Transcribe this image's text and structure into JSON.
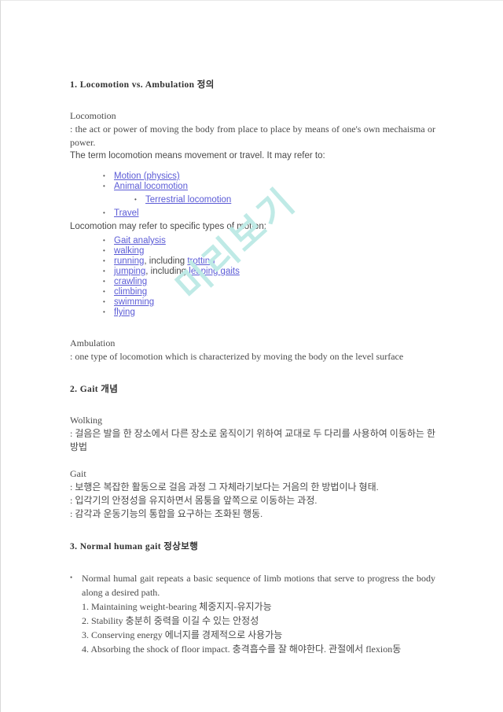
{
  "watermark": {
    "text": "미리보기"
  },
  "sections": {
    "s1": {
      "heading": "1. Locomotion vs. Ambulation 정의",
      "locomotion_title": "Locomotion",
      "locomotion_def": ": the act or power of moving the body from place to place by means of one's own mechaisma or power.",
      "locomotion_intro": "The term locomotion means movement or travel. It may refer to:",
      "links_1": [
        {
          "label": "Motion (physics)",
          "level": 1
        },
        {
          "label": "Animal locomotion",
          "level": 1
        },
        {
          "label": "Terrestrial locomotion",
          "level": 2
        },
        {
          "label": "Travel",
          "level": 1
        }
      ],
      "specific_intro": "Locomotion may refer to specific types of motion:",
      "links_2": [
        {
          "pre": "",
          "label": "Gait analysis",
          "mid": "",
          "label2": "",
          "post": ""
        },
        {
          "pre": "",
          "label": "walking",
          "mid": "",
          "label2": "",
          "post": ""
        },
        {
          "pre": "",
          "label": "running",
          "mid": ", including ",
          "label2": "trotting",
          "post": ""
        },
        {
          "pre": "",
          "label": "jumping",
          "mid": ", including ",
          "label2": "leaping gaits",
          "post": ""
        },
        {
          "pre": "",
          "label": "crawling",
          "mid": "",
          "label2": "",
          "post": ""
        },
        {
          "pre": "",
          "label": "climbing",
          "mid": "",
          "label2": "",
          "post": ""
        },
        {
          "pre": "",
          "label": "swimming",
          "mid": "",
          "label2": "",
          "post": ""
        },
        {
          "pre": "",
          "label": "flying",
          "mid": "",
          "label2": "",
          "post": ""
        }
      ],
      "ambulation_title": "Ambulation",
      "ambulation_def": ": one type of locomotion which is characterized by moving the body on the level surface"
    },
    "s2": {
      "heading": "2. Gait 개념",
      "wolking_title": "Wolking",
      "wolking_def": ": 걸음은 발을 한 장소에서 다른 장소로 움직이기 위하여 교대로 두 다리를 사용하여 이동하는 한 방법",
      "gait_title": "Gait",
      "gait_defs": [
        ": 보행은 복잡한 활동으로 걸음 과정 그 자체라기보다는 거음의 한 방법이나 형태.",
        ": 입각기의 안정성을 유지하면서 몸퉁을 앞쪽으로 이동하는 과정.",
        ": 감각과 운동기능의 통합을 요구하는 조화된 행동."
      ]
    },
    "s3": {
      "heading": "3. Normal human gait 정상보행",
      "bullet": "Normal humal gait repeats a basic sequence of limb motions that serve to progress the body along a desired path.",
      "items": [
        "1. Maintaining weight-bearing 체중지지-유지가능",
        "2. Stability 충분히 중력을 이길 수 있는 안정성",
        "3. Conserving energy 에너지를 경제적으로 사용가능",
        "4. Absorbing the shock of floor impact. 충격흡수를 잘 해야한다. 관절에서 flexion동"
      ]
    }
  }
}
